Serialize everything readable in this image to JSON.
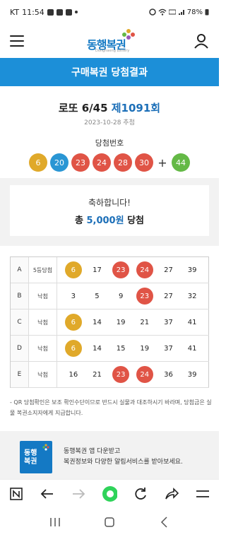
{
  "status": {
    "carrier": "KT",
    "time": "11:54",
    "battery": "78%"
  },
  "header": {
    "logo_text": "동행복권",
    "logo_sub": "Donghaeng Lottery"
  },
  "title_bar": "구매복권 당첨결과",
  "round": {
    "game": "로또 6/45",
    "round": "제1091회",
    "date": "2023-10-28 추첨"
  },
  "winning": {
    "label": "당첨번호",
    "numbers": [
      {
        "n": "6",
        "color": "y"
      },
      {
        "n": "20",
        "color": "b"
      },
      {
        "n": "23",
        "color": "r"
      },
      {
        "n": "24",
        "color": "r"
      },
      {
        "n": "28",
        "color": "r"
      },
      {
        "n": "30",
        "color": "r"
      }
    ],
    "plus": "+",
    "bonus": {
      "n": "44",
      "color": "g"
    }
  },
  "congrats": {
    "line1": "축하합니다!",
    "prefix": "총 ",
    "amount": "5,000원",
    "suffix": " 당첨"
  },
  "results": [
    {
      "set": "A",
      "rank": "5등당첨",
      "nums": [
        {
          "n": "6",
          "c": "y"
        },
        {
          "n": "17",
          "c": ""
        },
        {
          "n": "23",
          "c": "r"
        },
        {
          "n": "24",
          "c": "r"
        },
        {
          "n": "27",
          "c": ""
        },
        {
          "n": "39",
          "c": ""
        }
      ]
    },
    {
      "set": "B",
      "rank": "낙첨",
      "nums": [
        {
          "n": "3",
          "c": ""
        },
        {
          "n": "5",
          "c": ""
        },
        {
          "n": "9",
          "c": ""
        },
        {
          "n": "23",
          "c": "r"
        },
        {
          "n": "27",
          "c": ""
        },
        {
          "n": "32",
          "c": ""
        }
      ]
    },
    {
      "set": "C",
      "rank": "낙첨",
      "nums": [
        {
          "n": "6",
          "c": "y"
        },
        {
          "n": "14",
          "c": ""
        },
        {
          "n": "19",
          "c": ""
        },
        {
          "n": "21",
          "c": ""
        },
        {
          "n": "37",
          "c": ""
        },
        {
          "n": "41",
          "c": ""
        }
      ]
    },
    {
      "set": "D",
      "rank": "낙첨",
      "nums": [
        {
          "n": "6",
          "c": "y"
        },
        {
          "n": "14",
          "c": ""
        },
        {
          "n": "15",
          "c": ""
        },
        {
          "n": "19",
          "c": ""
        },
        {
          "n": "37",
          "c": ""
        },
        {
          "n": "41",
          "c": ""
        }
      ]
    },
    {
      "set": "E",
      "rank": "낙첨",
      "nums": [
        {
          "n": "16",
          "c": ""
        },
        {
          "n": "21",
          "c": ""
        },
        {
          "n": "23",
          "c": "r"
        },
        {
          "n": "24",
          "c": "r"
        },
        {
          "n": "36",
          "c": ""
        },
        {
          "n": "39",
          "c": ""
        }
      ]
    }
  ],
  "note": "- QR 당첨확인은 보조 확인수단이므로 반드시 실물과 대조하시기 바라며, 당첨금은 실물 복권소지자에게 지급합니다.",
  "promo": {
    "icon_text": "동행복권",
    "line1": "동행복권 앱 다운받고",
    "line2": "복권정보와 다양한 알림서비스를 받아보세요."
  },
  "colors": {
    "accent": "#1c8fd8",
    "yellow": "#e0a92a",
    "blue": "#2a96d4",
    "red": "#e05446",
    "green": "#64b946"
  },
  "icons": [
    "menu-icon",
    "user-icon",
    "n-home-icon",
    "back-arrow-icon",
    "forward-arrow-icon",
    "green-dot-icon",
    "refresh-icon",
    "share-icon",
    "hamburger-icon",
    "recent-apps-icon",
    "home-icon",
    "nav-back-icon"
  ]
}
